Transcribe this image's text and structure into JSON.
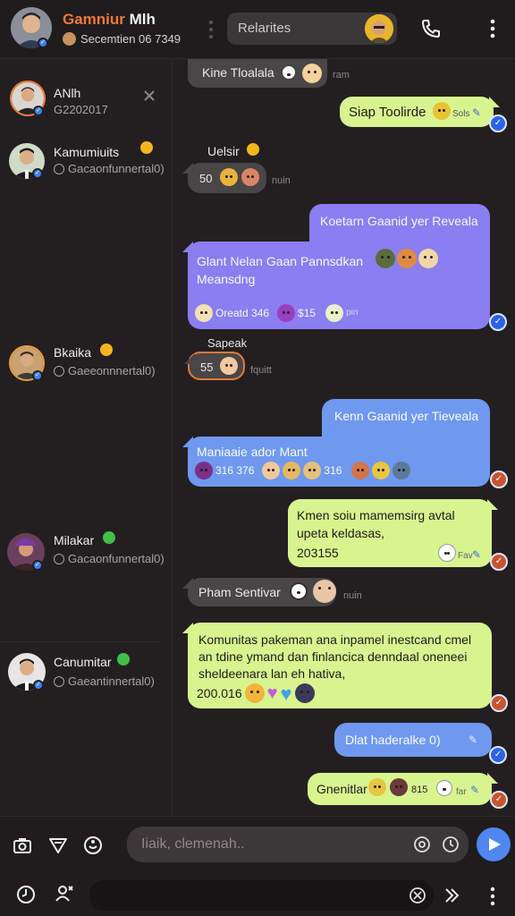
{
  "header": {
    "title_accent": "Gamniur",
    "title_rest": " Mlh",
    "subtitle": "Secemtien 06 7349",
    "search_label": "Relarites"
  },
  "sidebar": {
    "contacts": [
      {
        "name": "ANlh",
        "sub": "G2202017"
      },
      {
        "name": "Kamumiuits",
        "sub": "Gacaonfunnertal0)"
      },
      {
        "name": "Bkaika",
        "sub": "Gaeeonnnertal0)"
      },
      {
        "name": "Milakar",
        "sub": "Gacaonfunnertal0)"
      },
      {
        "name": "Canumitar",
        "sub": "Gaeantinnertal0)"
      }
    ]
  },
  "chat": {
    "m1": {
      "text": "Kine Tloalala",
      "meta": "ram"
    },
    "m2": {
      "text": "Siap Toolirde",
      "meta": "Sols"
    },
    "m3": {
      "sender": "Uelsir",
      "value": "50",
      "meta": "nuin"
    },
    "m4": {
      "header": "Koetarn Gaanid yer Reveala",
      "body": "Glant Nelan Gaan Pannsdkan Meansdng",
      "footer_a": "Oreatd 346",
      "footer_b": "$15",
      "footer_c": "pin"
    },
    "m5": {
      "sender": "Sapeak",
      "value": "55",
      "meta": "fquitt"
    },
    "m6": {
      "header": "Kenn Gaanid yer Tieveala",
      "body": "Maniaaie ador Mant",
      "footer_a": "316 376",
      "footer_b": "316"
    },
    "m7": {
      "text": "Kmen soiu mamemsirg avtal upeta keldasas,",
      "value": "203155",
      "meta": "Fav"
    },
    "m8": {
      "text": "Pham Sentivar",
      "meta": "nuin"
    },
    "m9": {
      "text": "Komunitas pakeman ana inpamel inestcand cmel an tdine ymand dan finlancica denndaal oneneei sheldeenara lan eh hativa,",
      "value": "200.016"
    },
    "m10": {
      "text": "Dlat haderalke 0)"
    },
    "m11": {
      "text": "Gnenitlar",
      "value": "815",
      "meta": "far"
    }
  },
  "composer": {
    "placeholder": "Iiaik, clemenah.."
  },
  "colors": {
    "accent_orange": "#f07a3a",
    "bubble_green": "#d7f48f",
    "bubble_purple": "#8a7ef0",
    "bubble_blue": "#6f98ef",
    "bubble_gray": "#4a4547",
    "send_blue": "#4f86f0"
  }
}
